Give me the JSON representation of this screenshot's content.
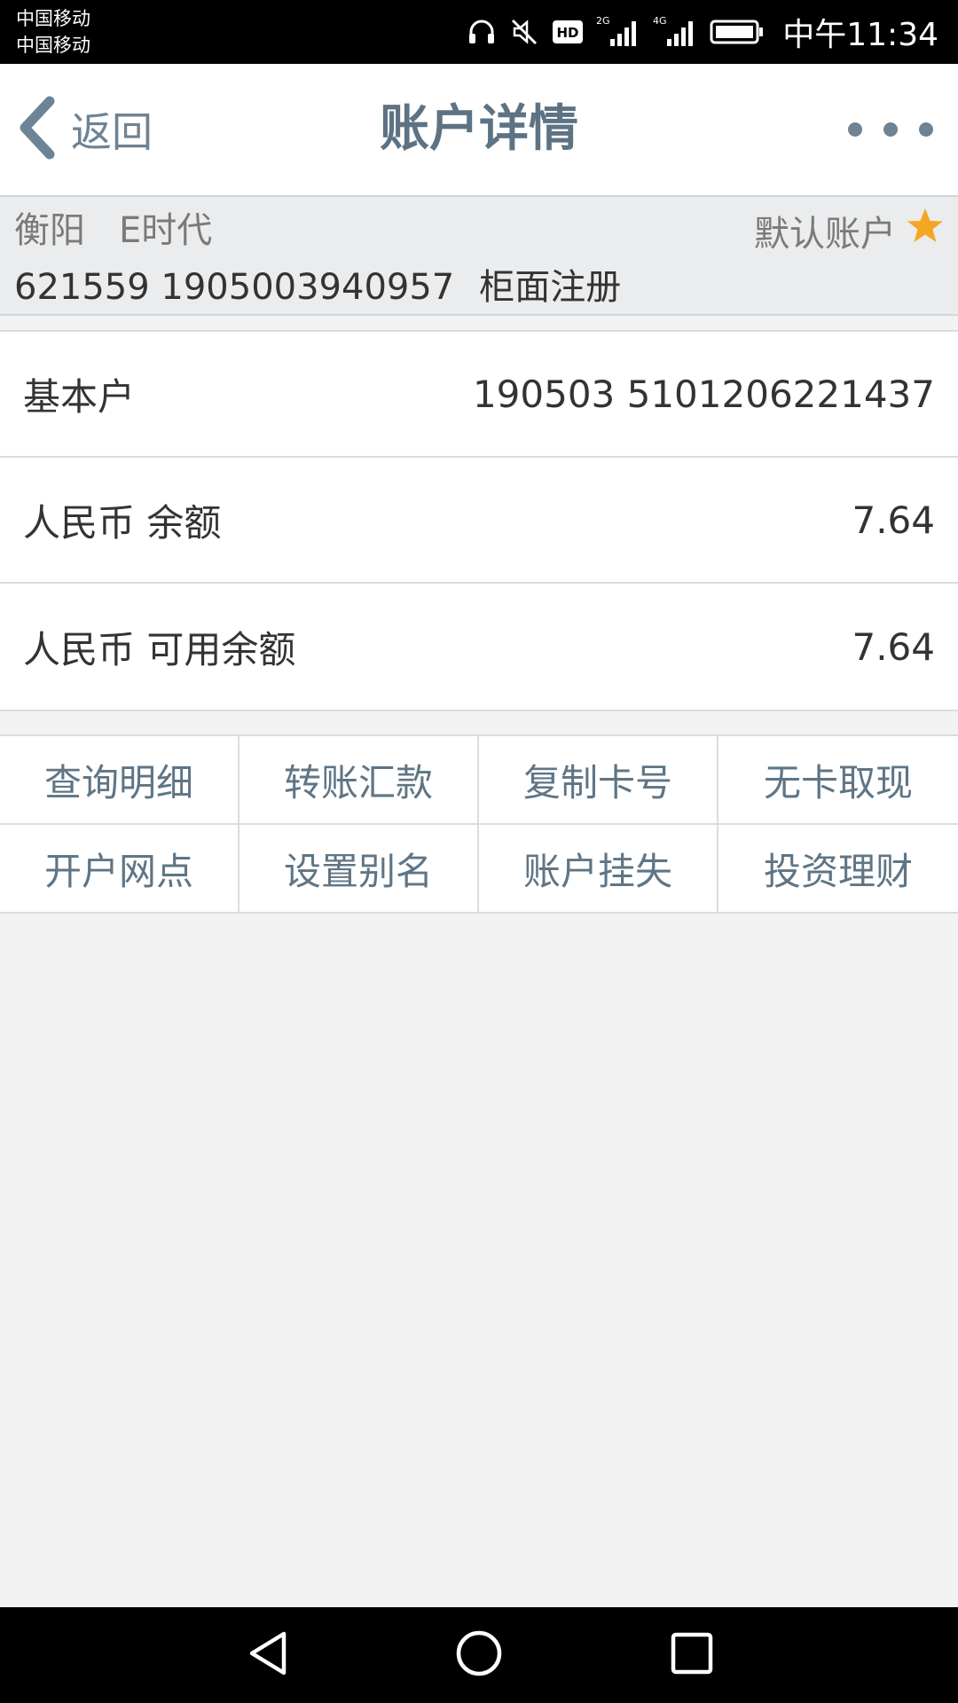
{
  "status_bar": {
    "carrier_1": "中国移动",
    "carrier_2": "中国移动",
    "hd_badge": "HD",
    "network_1": "2G",
    "network_2": "4G",
    "time": "中午11:34",
    "icons": [
      "headphones-icon",
      "mute-icon",
      "hd-icon",
      "signal-2g-icon",
      "signal-4g-icon",
      "battery-icon"
    ]
  },
  "header": {
    "back_label": "返回",
    "title": "账户详情",
    "more_icon": "more-dots-icon"
  },
  "account": {
    "city": "衡阳",
    "card_name": "E时代",
    "default_label": "默认账户",
    "card_number": "621559 1905003940957",
    "registration": "柜面注册"
  },
  "details": [
    {
      "label": "基本户",
      "value": "190503 5101206221437"
    },
    {
      "label": "人民币 余额",
      "value": "7.64"
    },
    {
      "label": "人民币 可用余额",
      "value": "7.64"
    }
  ],
  "actions": [
    "查询明细",
    "转账汇款",
    "复制卡号",
    "无卡取现",
    "开户网点",
    "设置别名",
    "账户挂失",
    "投资理财"
  ],
  "nav_bar": [
    "back-triangle-icon",
    "home-circle-icon",
    "recents-square-icon"
  ],
  "colors": {
    "accent": "#6e8393",
    "star": "#f5a623",
    "page_background": "#f2f2f2"
  }
}
